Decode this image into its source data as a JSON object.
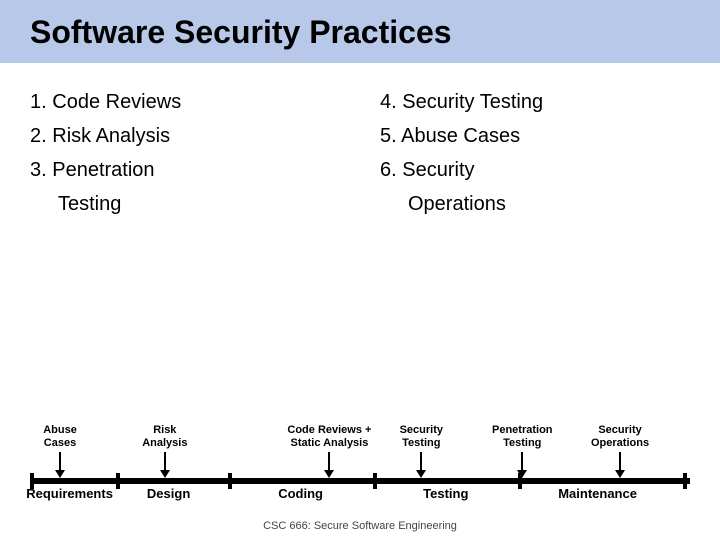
{
  "title": "Software Security Practices",
  "left_list": {
    "items": [
      {
        "number": "1.",
        "text": "Code Reviews"
      },
      {
        "number": "2.",
        "text": "Risk Analysis"
      },
      {
        "number": "3.",
        "text": "Penetration Testing",
        "multiline": true,
        "line2": "Testing"
      }
    ]
  },
  "right_list": {
    "items": [
      {
        "number": "4.",
        "text": "Security Testing"
      },
      {
        "number": "5.",
        "text": "Abuse Cases"
      },
      {
        "number": "6.",
        "text": "Security Operations",
        "multiline": true,
        "line2": "Operations"
      }
    ]
  },
  "timeline": {
    "arrows": [
      {
        "label": "Abuse Cases",
        "left_pct": 4
      },
      {
        "label": "Risk Analysis",
        "left_pct": 18
      },
      {
        "label": "Code Reviews + Static Analysis",
        "left_pct": 40
      },
      {
        "label": "Security Testing",
        "left_pct": 57
      },
      {
        "label": "Penetration Testing",
        "left_pct": 72
      },
      {
        "label": "Security Operations",
        "left_pct": 88
      }
    ],
    "phases": [
      {
        "label": "Requirements",
        "left_pct": 4
      },
      {
        "label": "Design",
        "left_pct": 20
      },
      {
        "label": "Coding",
        "left_pct": 42
      },
      {
        "label": "Testing",
        "left_pct": 63
      },
      {
        "label": "Maintenance",
        "left_pct": 84
      }
    ],
    "ticks": [
      0,
      13,
      30,
      52,
      74,
      100
    ]
  },
  "footer": "CSC 666: Secure Software Engineering"
}
